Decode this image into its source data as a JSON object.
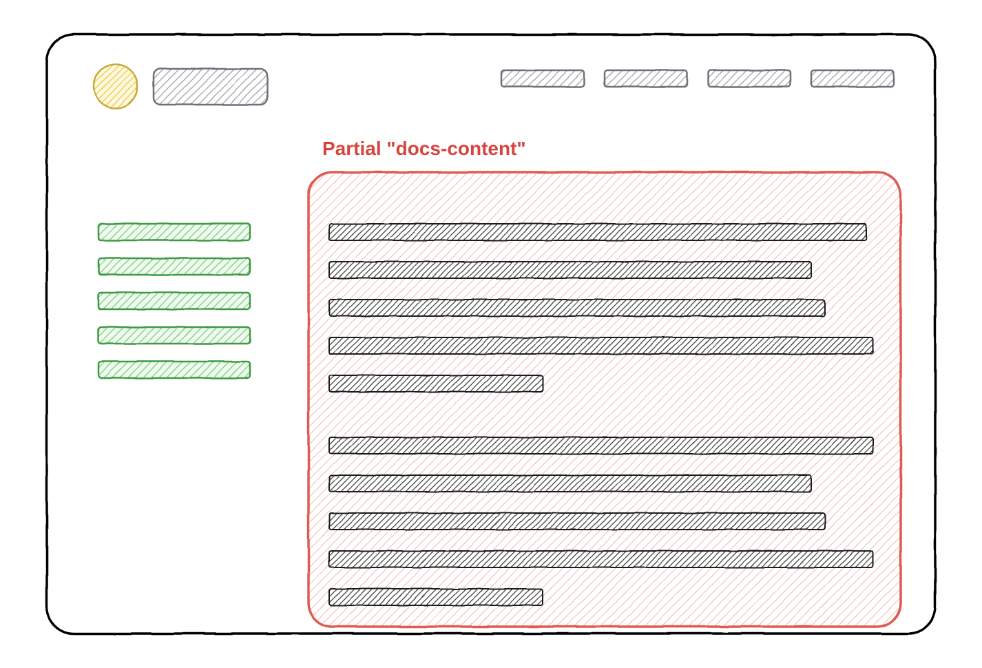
{
  "annotation_label": "Partial \"docs-content\"",
  "colors": {
    "window_border": "#000000",
    "header_fill": "#c9ccd0",
    "logo_fill": "#f5d547",
    "nav_fill": "#66c06a",
    "content_border": "#e2635c",
    "content_fill": "#fbe9e7",
    "text_fill": "#4d4d4d",
    "annotation_text": "#d6453d"
  },
  "nav_items_count": 5,
  "content": {
    "paragraph1_lines": 5,
    "paragraph2_lines": 5
  }
}
